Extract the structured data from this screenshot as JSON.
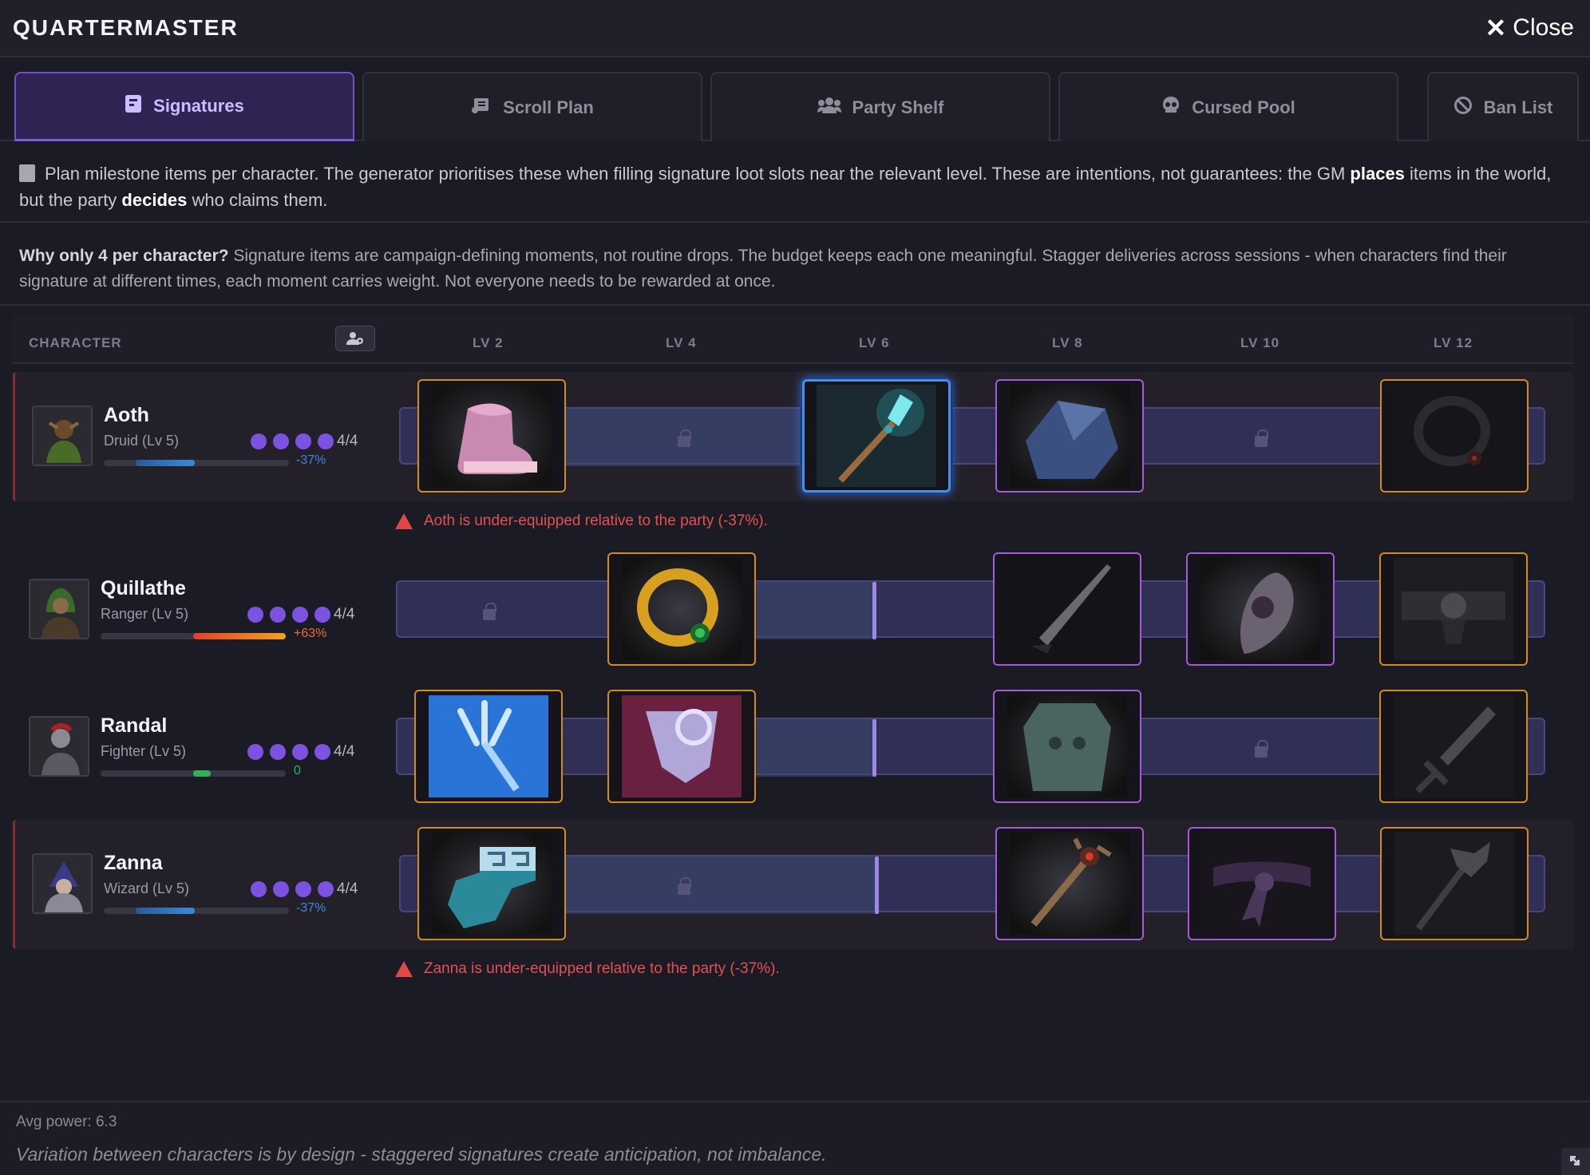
{
  "window": {
    "title": "QUARTERMASTER",
    "close_label": "Close"
  },
  "tabs": [
    {
      "label": "Signatures",
      "icon": "book-icon"
    },
    {
      "label": "Scroll Plan",
      "icon": "scroll-icon"
    },
    {
      "label": "Party Shelf",
      "icon": "group-icon"
    },
    {
      "label": "Cursed Pool",
      "icon": "skull-icon"
    },
    {
      "label": "Ban List",
      "icon": "ban-icon"
    }
  ],
  "info": {
    "text1": "Plan milestone items per character. The generator prioritises these when filling signature loot slots near the relevant level. These are intentions, not guarantees: the GM ",
    "bold1": "places",
    "text2": " items in the world, but the party ",
    "bold2": "decides",
    "text3": " who claims them."
  },
  "why": {
    "bold": "Why only 4 per character?",
    "text": " Signature items are campaign-defining moments, not routine drops. The budget keeps each one meaningful. Stagger deliveries across sessions - when characters find their signature at different times, each moment carries weight. Not everyone needs to be rewarded at once."
  },
  "table": {
    "character_header": "CHARACTER",
    "levels": [
      "LV 2",
      "LV 4",
      "LV 6",
      "LV 8",
      "LV 10",
      "LV 12"
    ]
  },
  "characters": [
    {
      "name": "Aoth",
      "class": "Druid (Lv 5)",
      "count": "4/4",
      "delta": "-37%",
      "delta_fraction": -0.37,
      "color": "#3a8bd6",
      "warning": "Aoth is under-equipped relative to the party (-37%).",
      "items": [
        "boots-icon",
        null,
        "spear-icon",
        "stone-icon",
        null,
        "amulet-icon"
      ]
    },
    {
      "name": "Quillathe",
      "class": "Ranger (Lv 5)",
      "count": "4/4",
      "delta": "+63%",
      "delta_fraction": 0.63,
      "color": "#f06a30",
      "items": [
        null,
        "ring-icon",
        null,
        "blade-icon",
        "shield-icon",
        "belt-icon"
      ]
    },
    {
      "name": "Randal",
      "class": "Fighter (Lv 5)",
      "count": "4/4",
      "delta": "0",
      "delta_fraction": 0,
      "color": "#34b058",
      "items": [
        "trident-icon",
        "cloak-icon",
        null,
        "armor-icon",
        null,
        "sword-icon"
      ]
    },
    {
      "name": "Zanna",
      "class": "Wizard (Lv 5)",
      "count": "4/4",
      "delta": "-37%",
      "delta_fraction": -0.37,
      "color": "#3a8bd6",
      "warning": "Zanna is under-equipped relative to the party (-37%).",
      "items": [
        "gloves-icon",
        null,
        null,
        "wand-icon",
        "sash-icon",
        "staff-icon"
      ]
    }
  ],
  "footer": {
    "avg_power": "Avg power: 6.3",
    "note": "Variation between characters is by design - staggered signatures create anticipation, not imbalance."
  }
}
